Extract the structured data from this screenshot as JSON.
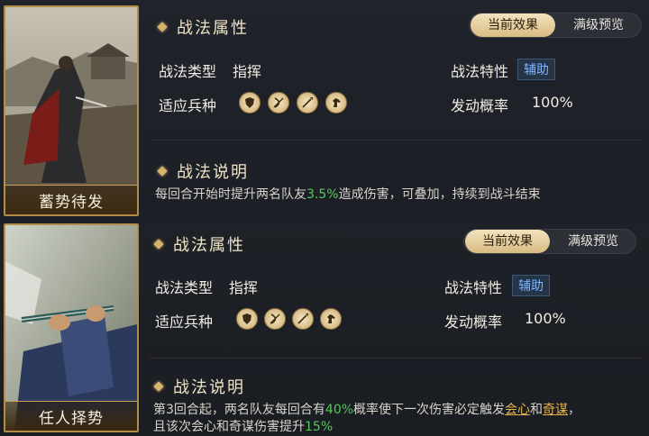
{
  "skills": [
    {
      "card_name": "蓄势待发",
      "attr_title": "战法属性",
      "toggle": {
        "current": "当前效果",
        "max": "满级预览"
      },
      "type_label": "战法类型",
      "type_value": "指挥",
      "feature_label": "战法特性",
      "feature_value": "辅助",
      "troops_label": "适应兵种",
      "troops": [
        "shield-icon",
        "bow-icon",
        "spear-icon",
        "horse-icon"
      ],
      "chance_label": "发动概率",
      "chance_value": "100%",
      "desc_title": "战法说明",
      "desc": {
        "part1": "每回合开始时提升两名队友",
        "num1": "3.5%",
        "part2": "造成伤害，可叠加，持续到战斗结束"
      }
    },
    {
      "card_name": "任人择势",
      "attr_title": "战法属性",
      "toggle": {
        "current": "当前效果",
        "max": "满级预览"
      },
      "type_label": "战法类型",
      "type_value": "指挥",
      "feature_label": "战法特性",
      "feature_value": "辅助",
      "troops_label": "适应兵种",
      "troops": [
        "shield-icon",
        "bow-icon",
        "spear-icon",
        "horse-icon"
      ],
      "chance_label": "发动概率",
      "chance_value": "100%",
      "desc_title": "战法说明",
      "desc": {
        "line1_a": "第3回合起，两名队友每回合有",
        "num1": "40%",
        "line1_b": "概率使下一次伤害必定触发",
        "link1": "会心",
        "line1_c": "和",
        "link2": "奇谋",
        "line1_d": "，",
        "line2_a": "且该次会心和奇谋伤害提升",
        "num2": "15%"
      }
    }
  ],
  "colors": {
    "accent_gold": "#d8b36a",
    "green": "#55c85a",
    "tag_blue": "#7fb6ff"
  }
}
